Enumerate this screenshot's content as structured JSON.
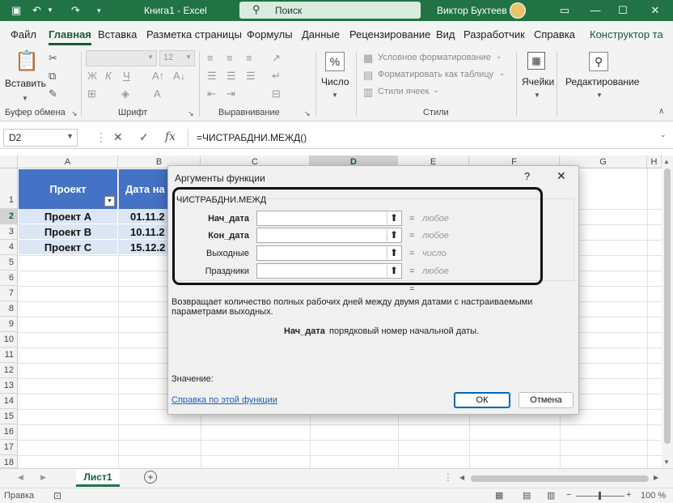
{
  "app": {
    "doc_title": "Книга1  -  Excel",
    "search_placeholder": "Поиск",
    "user_name": "Виктор Бухтеев"
  },
  "tabs": [
    "Файл",
    "Главная",
    "Вставка",
    "Разметка страницы",
    "Формулы",
    "Данные",
    "Рецензирование",
    "Вид",
    "Разработчик",
    "Справка",
    "Конструктор та"
  ],
  "ribbon": {
    "clipboard": {
      "paste_label": "Вставить",
      "group_label": "Буфер обмена"
    },
    "font": {
      "font_size": "12",
      "group_label": "Шрифт"
    },
    "alignment": {
      "group_label": "Выравнивание"
    },
    "number": {
      "label": "Число"
    },
    "styles": {
      "conditional": "Условное форматирование",
      "format_table": "Форматировать как таблицу",
      "cell_styles": "Стили ячеек",
      "group_label": "Стили"
    },
    "cells": {
      "label": "Ячейки"
    },
    "editing": {
      "label": "Редактирование"
    }
  },
  "formula_bar": {
    "name_box": "D2",
    "formula": "=ЧИСТРАБДНИ.МЕЖД()"
  },
  "sheet": {
    "columns": [
      "A",
      "B",
      "C",
      "D",
      "E",
      "F",
      "G",
      "H"
    ],
    "rows": [
      "1",
      "2",
      "3",
      "4",
      "5",
      "6",
      "7",
      "8",
      "9",
      "10",
      "11",
      "12",
      "13",
      "14",
      "15",
      "16",
      "17",
      "18"
    ],
    "header_a": "Проект",
    "header_b": "Дата на",
    "projects": [
      "Проект А",
      "Проект В",
      "Проект С"
    ],
    "dates": [
      "01.11.2",
      "10.11.2",
      "15.12.2"
    ]
  },
  "sheet_tab": "Лист1",
  "status": {
    "ready": "Правка",
    "zoom": "100 %"
  },
  "dialog": {
    "title": "Аргументы функции",
    "function_name": "ЧИСТРАБДНИ.МЕЖД",
    "args": [
      {
        "label": "Нач_дата",
        "type": "любое"
      },
      {
        "label": "Кон_дата",
        "type": "любое"
      },
      {
        "label": "Выходные",
        "type": "число"
      },
      {
        "label": "Праздники",
        "type": "любое"
      }
    ],
    "eq": "=",
    "description": "Возвращает количество полных рабочих дней между двумя датами с настраиваемыми параметрами выходных.",
    "arg_desc_name": "Нач_дата",
    "arg_desc_text": "порядковый номер начальной даты.",
    "value_label": "Значение:",
    "help_link": "Справка по этой функции",
    "ok_label": "ОК",
    "cancel_label": "Отмена"
  }
}
